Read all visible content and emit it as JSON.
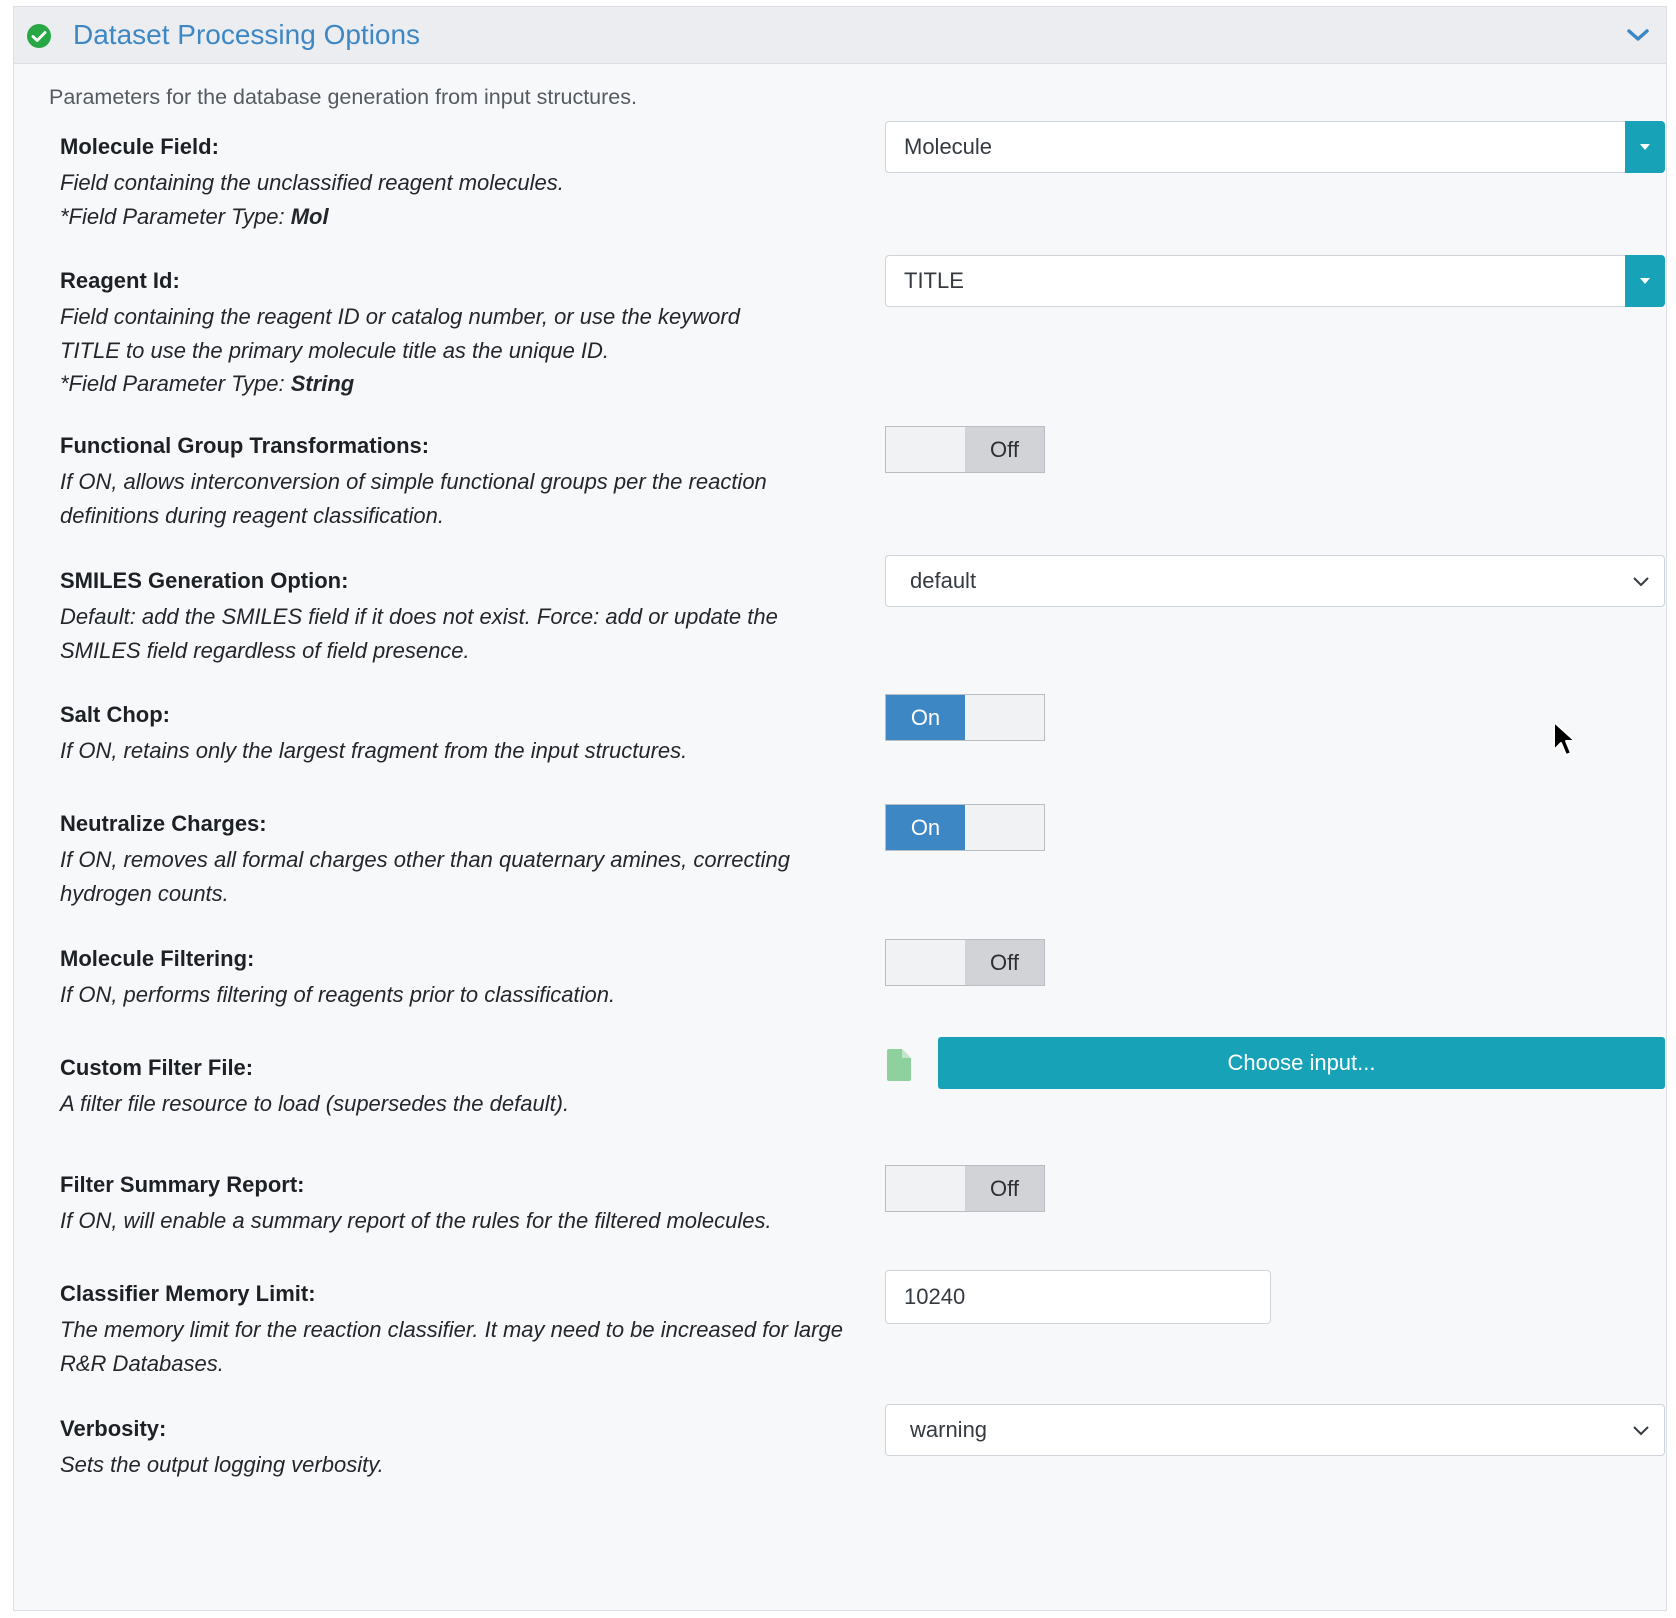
{
  "panel": {
    "title": "Dataset Processing Options",
    "description": "Parameters for the database generation from input structures."
  },
  "fields": {
    "molecule_field": {
      "label": "Molecule Field:",
      "desc": "Field containing the unclassified reagent molecules.",
      "ptype_prefix": "*Field Parameter Type: ",
      "ptype": "Mol",
      "value": "Molecule"
    },
    "reagent_id": {
      "label": "Reagent Id:",
      "desc": "Field containing the reagent ID or catalog number, or use the keyword TITLE to use the primary molecule title as the unique ID.",
      "ptype_prefix": "*Field Parameter Type: ",
      "ptype": "String",
      "value": "TITLE"
    },
    "functional_group": {
      "label": "Functional Group Transformations:",
      "desc": "If ON, allows interconversion of simple functional groups per the reaction definitions during reagent classification.",
      "toggle": "Off"
    },
    "smiles_option": {
      "label": "SMILES Generation Option:",
      "desc": "Default: add the SMILES field if it does not exist. Force: add or update the SMILES field regardless of field presence.",
      "value": "default"
    },
    "salt_chop": {
      "label": "Salt Chop:",
      "desc": "If ON, retains only the largest fragment from the input structures.",
      "toggle": "On"
    },
    "neutralize": {
      "label": "Neutralize Charges:",
      "desc": "If ON, removes all formal charges other than quaternary amines, correcting hydrogen counts.",
      "toggle": "On"
    },
    "molecule_filtering": {
      "label": "Molecule Filtering:",
      "desc": "If ON, performs filtering of reagents prior to classification.",
      "toggle": "Off"
    },
    "custom_filter": {
      "label": "Custom Filter File:",
      "desc": "A filter file resource to load (supersedes the default).",
      "button": "Choose input..."
    },
    "filter_summary": {
      "label": "Filter Summary Report:",
      "desc": "If ON, will enable a summary report of the rules for the filtered molecules.",
      "toggle": "Off"
    },
    "memory_limit": {
      "label": "Classifier Memory Limit:",
      "desc": "The memory limit for the reaction classifier. It may need to be increased for large R&R Databases.",
      "value": "10240"
    },
    "verbosity": {
      "label": "Verbosity:",
      "desc": "Sets the output logging verbosity.",
      "value": "warning"
    }
  },
  "colors": {
    "accent_blue": "#3d87c5",
    "teal": "#17a2b8",
    "success_green": "#28a745"
  }
}
